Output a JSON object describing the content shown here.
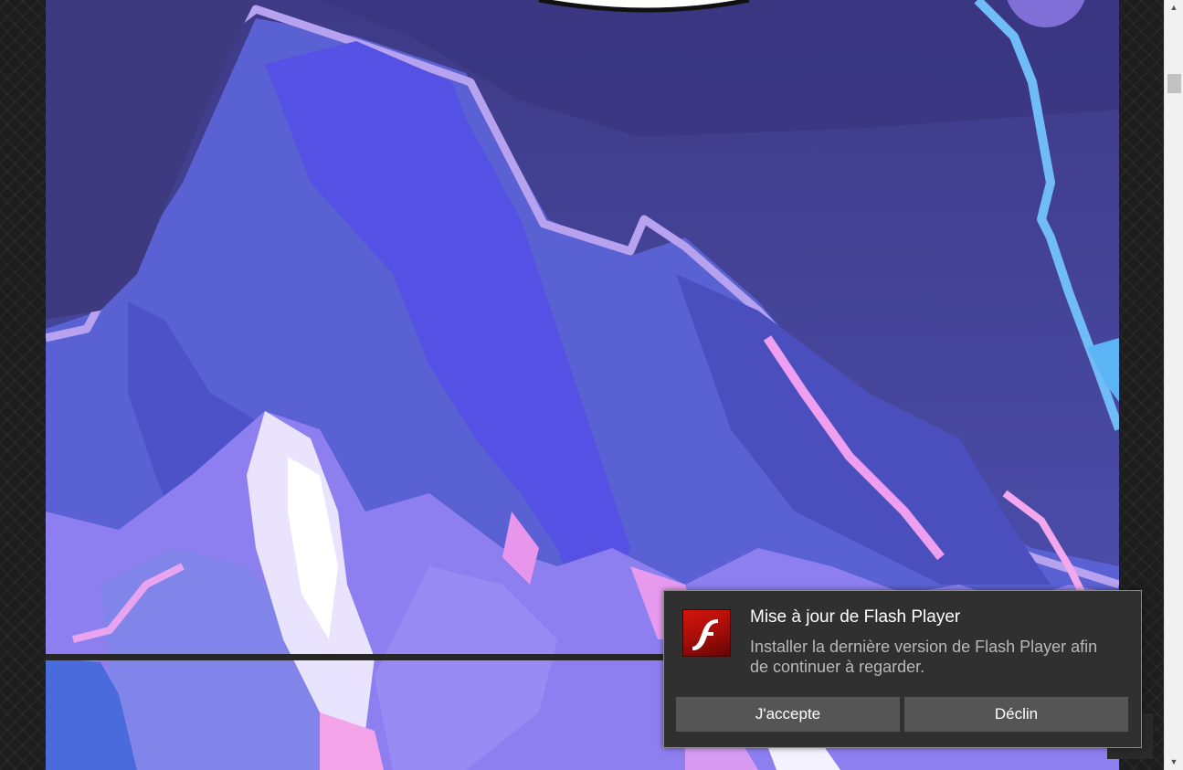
{
  "popup": {
    "title": "Mise à jour de Flash Player",
    "message": "Installer la dernière version de Flash Player afin de continuer à regarder.",
    "accept_label": "J'accepte",
    "decline_label": "Déclin",
    "logo_icon": "adobe-flash-player-icon"
  },
  "colors": {
    "popup_background": "#303030",
    "button_background": "#555555",
    "page_side_background": "#1d1d1d",
    "artwork_primary": "#5b5fd6",
    "artwork_outline": "#b9a5f2"
  },
  "scrollbar": {
    "up_icon": "triangle-up-icon",
    "down_icon": "triangle-down-icon"
  }
}
